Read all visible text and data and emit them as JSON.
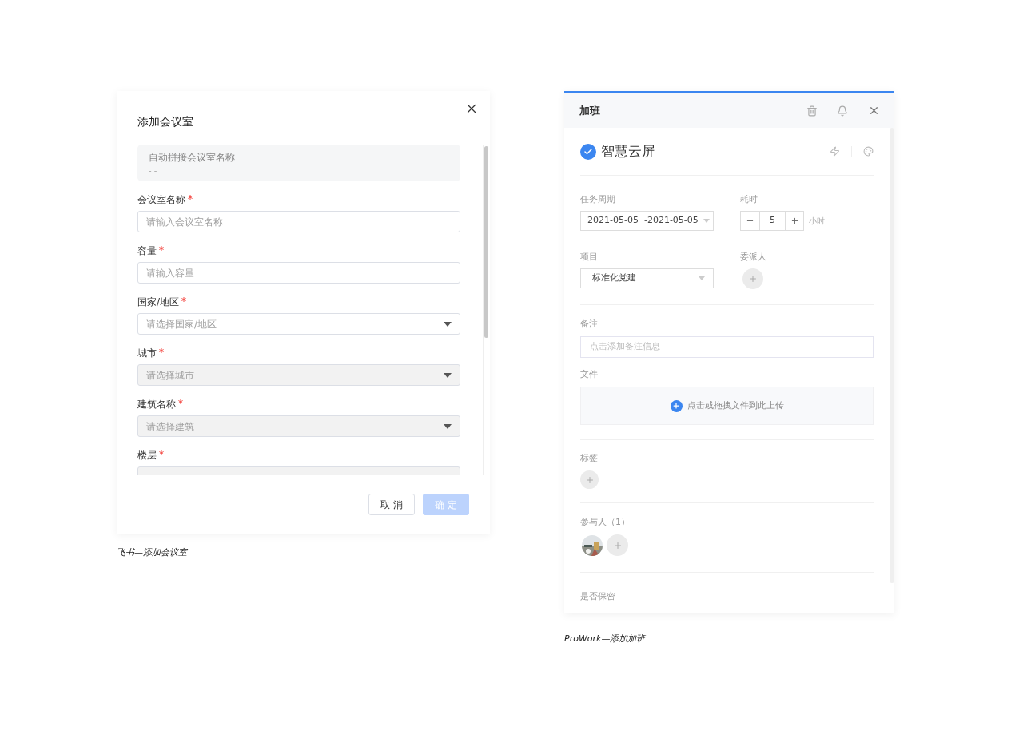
{
  "meeting_room_dialog": {
    "title": "添加会议室",
    "summary": {
      "label": "自动拼接会议室名称",
      "value": "- -"
    },
    "fields": [
      {
        "label": "会议室名称",
        "required": true,
        "kind": "input",
        "disabled": false,
        "placeholder": "请输入会议室名称"
      },
      {
        "label": "容量",
        "required": true,
        "kind": "input",
        "disabled": false,
        "placeholder": "请输入容量"
      },
      {
        "label": "国家/地区",
        "required": true,
        "kind": "select",
        "disabled": false,
        "placeholder": "请选择国家/地区"
      },
      {
        "label": "城市",
        "required": true,
        "kind": "select",
        "disabled": true,
        "placeholder": "请选择城市"
      },
      {
        "label": "建筑名称",
        "required": true,
        "kind": "select",
        "disabled": true,
        "placeholder": "请选择建筑"
      },
      {
        "label": "楼层",
        "required": true,
        "kind": "select",
        "disabled": true
      }
    ],
    "buttons": [
      {
        "label": "取 消",
        "primary": false,
        "disabled": false
      },
      {
        "label": "确 定",
        "primary": true,
        "disabled": true
      }
    ],
    "caption": "飞书—添加会议室"
  },
  "overtime_panel": {
    "title": "加班",
    "task": {
      "name": "智慧云屏",
      "completed": true
    },
    "period": {
      "label": "任务周期",
      "value": "2021-05-05  -2021-05-05"
    },
    "duration": {
      "label": "耗时",
      "value": "5",
      "unit": "小时"
    },
    "project": {
      "label": "项目",
      "value": "标准化党建"
    },
    "assignee": {
      "label": "委派人"
    },
    "note": {
      "label": "备注",
      "placeholder": "点击添加备注信息"
    },
    "files": {
      "label": "文件",
      "hint": "点击或拖拽文件到此上传"
    },
    "tags": {
      "label": "标签"
    },
    "participants": {
      "label": "参与人（1）"
    },
    "confidential": {
      "label": "是否保密"
    },
    "caption": "ProWork—添加加班"
  }
}
